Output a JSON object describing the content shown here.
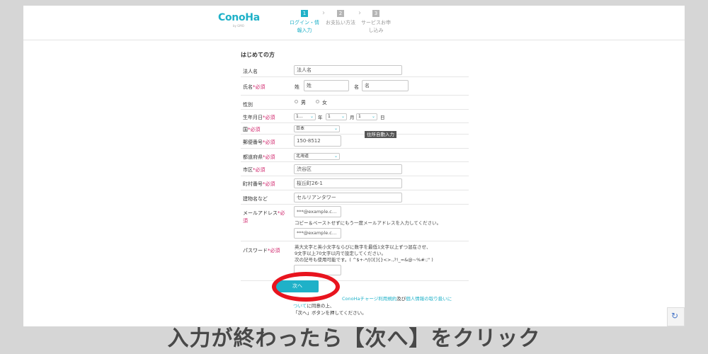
{
  "header": {
    "logo": "ConoHa",
    "logo_sub": "by GMO",
    "steps": [
      {
        "num": "1",
        "label_line1": "ログイン・情",
        "label_line2": "報入力"
      },
      {
        "num": "2",
        "label_line1": "お支払い方法",
        "label_line2": ""
      },
      {
        "num": "3",
        "label_line1": "サービスお申",
        "label_line2": "し込み"
      }
    ],
    "arrow": "›"
  },
  "form": {
    "intro": "はじめての方",
    "required_mark": "*必須",
    "company": {
      "label": "法人名",
      "placeholder": "法人名"
    },
    "name": {
      "label": "氏名",
      "last_label": "姓",
      "last_placeholder": "姓",
      "first_label": "名",
      "first_placeholder": "名"
    },
    "gender": {
      "label": "性別",
      "male": "男",
      "female": "女"
    },
    "birthday": {
      "label": "生年月日",
      "year": "1…",
      "year_unit": "年",
      "month": "1",
      "month_unit": "月",
      "day": "1",
      "day_unit": "日"
    },
    "country": {
      "label": "国",
      "value": "日本"
    },
    "postal": {
      "label": "郵便番号",
      "value": "150-8512",
      "auto_button": "住所自動入力"
    },
    "prefecture": {
      "label": "都道府県",
      "value": "北海道"
    },
    "city": {
      "label": "市区",
      "placeholder": "渋谷区"
    },
    "town": {
      "label": "町村番号",
      "placeholder": "桜丘町26-1"
    },
    "building": {
      "label": "建物名など",
      "placeholder": "セルリアンタワー"
    },
    "email": {
      "label": "メールアドレス",
      "req_part1": "*必",
      "req_part2": "須",
      "placeholder": "***@example.c…",
      "confirm_note": "コピー＆ペーストせずにもう一度メールアドレスを入力してください。",
      "confirm_placeholder": "***@example.c…"
    },
    "password": {
      "label": "パスワード",
      "note1": "英大文字と英小文字ならびに数字を最低1文字以上ずつ混在させ、",
      "note2": "9文字以上70文字以内で設定してください。",
      "note3": "次の記号も使用可能です。( ^$+-*/|()[]{}<>.,?!_=&@~%#:;\" )"
    }
  },
  "next_button": "次へ",
  "agreement": {
    "text_pre": "ConoHaチャージ利用規約",
    "text_and": "及び",
    "text_privacy": "個人情報の取り扱いに",
    "text_privacy2": "ついて",
    "text_agree": "に同意の上、",
    "text_press": "「次へ」ボタンを押してください。"
  },
  "caption": "入力が終わったら【次へ】をクリック",
  "colors": {
    "accent": "#1fb1c8",
    "required": "#d0246b",
    "highlight_circle": "#e8141e"
  }
}
